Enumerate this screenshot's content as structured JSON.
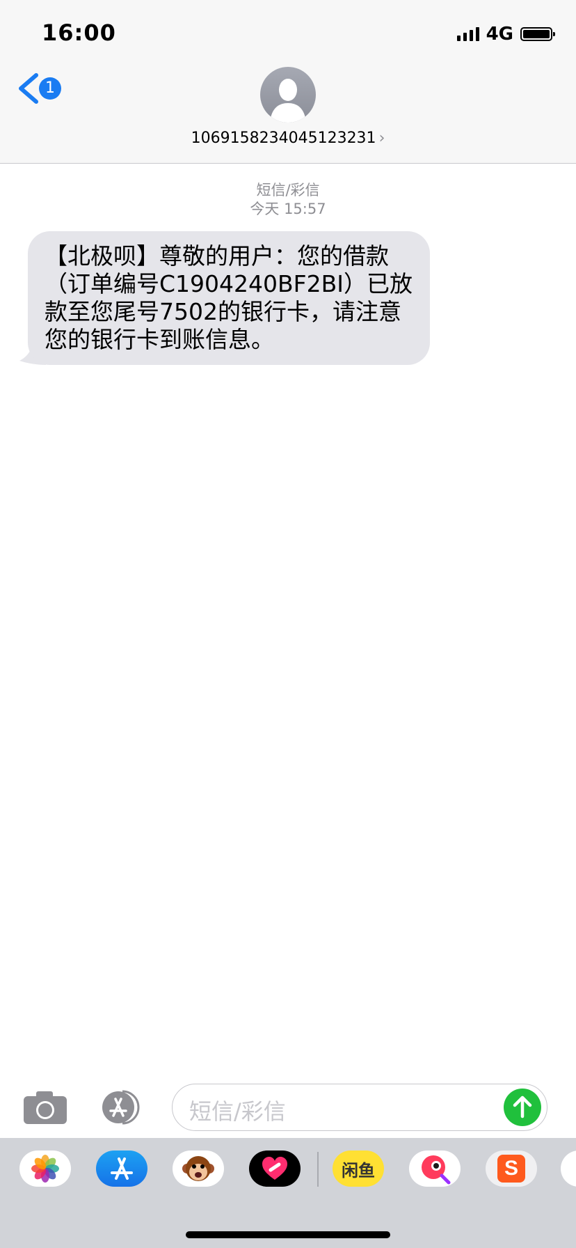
{
  "status_bar": {
    "time": "16:00",
    "network": "4G"
  },
  "header": {
    "back_badge": "1",
    "contact": "1069158234045123231",
    "contact_chevron": "›"
  },
  "conversation": {
    "channel": "短信/彩信",
    "timestamp": "今天 15:57",
    "message": "【北极呗】尊敬的用户：您的借款（订单编号C1904240BF2BI）已放款至您尾号7502的银行卡，请注意您的银行卡到账信息。"
  },
  "input": {
    "placeholder": "短信/彩信"
  },
  "app_drawer": {
    "apps": [
      {
        "name": "photos-icon"
      },
      {
        "name": "app-store-icon"
      },
      {
        "name": "animoji-monkey-icon"
      },
      {
        "name": "digital-touch-icon"
      },
      {
        "name": "xianyu-icon",
        "label": "闲鱼"
      },
      {
        "name": "search-app-icon"
      },
      {
        "name": "sogou-icon",
        "label": "S"
      }
    ]
  },
  "colors": {
    "accent": "#1a7cf2",
    "send": "#20c03c",
    "bubble": "#e5e5ea"
  }
}
